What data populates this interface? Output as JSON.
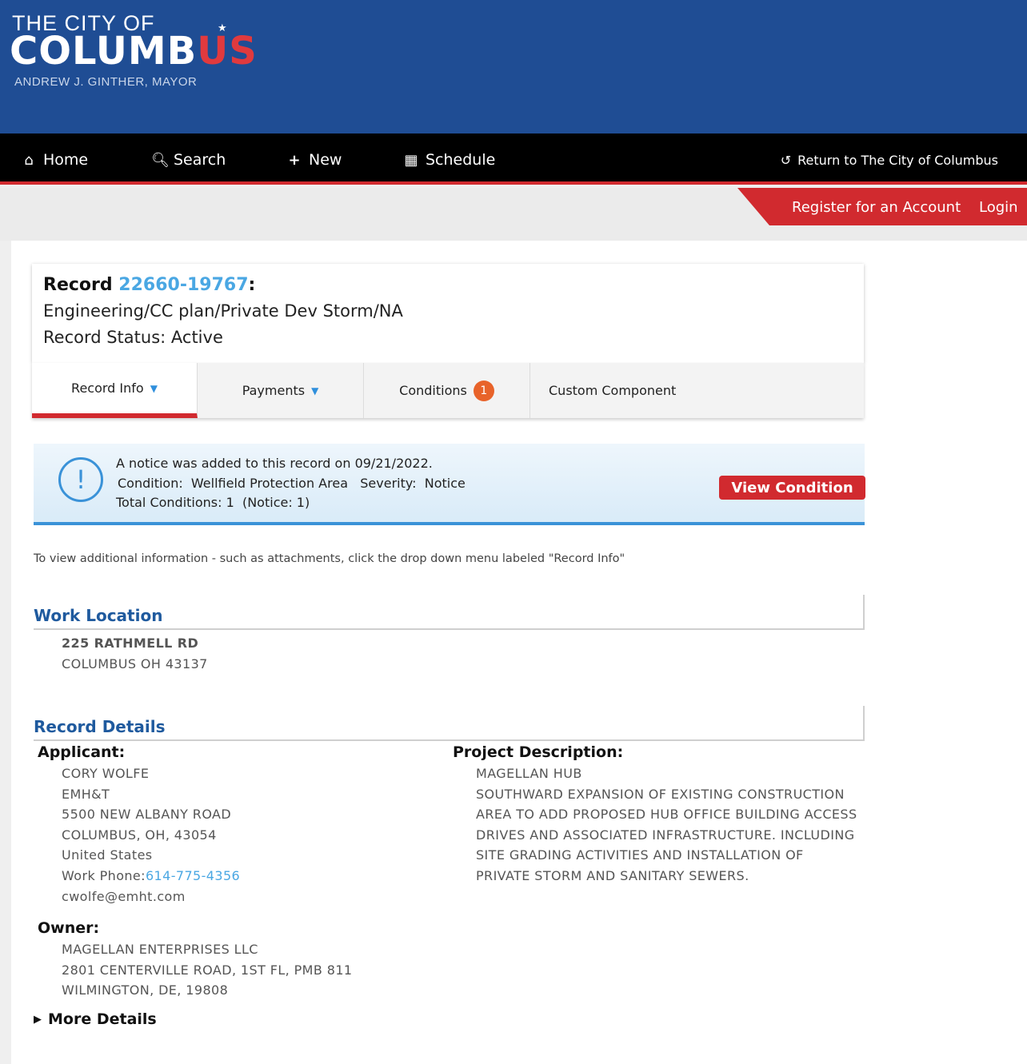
{
  "header": {
    "logo_line1": "THE CITY OF",
    "logo_line2a": "COLUMB",
    "logo_line2b": "US",
    "logo_line3": "ANDREW J. GINTHER, MAYOR",
    "brand_blue": "#1f4d94",
    "accent_red": "#d12a2f"
  },
  "nav": {
    "items": [
      {
        "label": "Home",
        "icon": "home-icon"
      },
      {
        "label": "Search",
        "icon": "search-icon"
      },
      {
        "label": "New",
        "icon": "plus-icon"
      },
      {
        "label": "Schedule",
        "icon": "calendar-icon"
      }
    ],
    "return_label": "Return to The City of Columbus"
  },
  "account": {
    "register": "Register for an Account",
    "login": "Login"
  },
  "record": {
    "prefix": "Record",
    "number": "22660-19767",
    "suffix": ":",
    "type": "Engineering/CC plan/Private Dev Storm/NA",
    "status": "Record Status: Active"
  },
  "tabs": [
    {
      "label": "Record Info",
      "active": true
    },
    {
      "label": "Payments"
    },
    {
      "label": "Conditions",
      "badge": "1"
    },
    {
      "label": "Custom Component"
    }
  ],
  "notice": {
    "line1": "A notice was added to this record on 09/21/2022.",
    "line2": "Condition:  Wellfield Protection Area   Severity:  Notice",
    "line3": "Total Conditions: 1  (Notice: 1)",
    "button": "View Condition"
  },
  "hint": "To view additional information - such as attachments, click the drop down menu labeled \"Record Info\"",
  "work_location": {
    "title": "Work Location",
    "street": "225 RATHMELL RD",
    "city": "COLUMBUS OH 43137"
  },
  "details": {
    "title": "Record Details",
    "applicant_label": "Applicant:",
    "applicant": {
      "name": "CORY WOLFE",
      "company": "EMH&T",
      "address": "5500 NEW ALBANY ROAD",
      "city": "COLUMBUS, OH, 43054",
      "country": "United States",
      "phone_label": "Work Phone:",
      "phone": "614-775-4356",
      "email": "cwolfe@emht.com"
    },
    "owner_label": "Owner:",
    "owner": {
      "name": "MAGELLAN ENTERPRISES LLC",
      "address": "2801 CENTERVILLE ROAD, 1ST FL, PMB 811",
      "city": "WILMINGTON, DE, 19808"
    },
    "project_label": "Project Description:",
    "project": {
      "name": "MAGELLAN HUB",
      "lines": [
        "SOUTHWARD EXPANSION OF EXISTING CONSTRUCTION",
        "AREA TO ADD PROPOSED HUB OFFICE BUILDING ACCESS",
        "DRIVES AND ASSOCIATED INFRASTRUCTURE. INCLUDING",
        "SITE GRADING ACTIVITIES AND INSTALLATION OF",
        "PRIVATE STORM AND SANITARY SEWERS."
      ]
    },
    "more": "More Details"
  }
}
